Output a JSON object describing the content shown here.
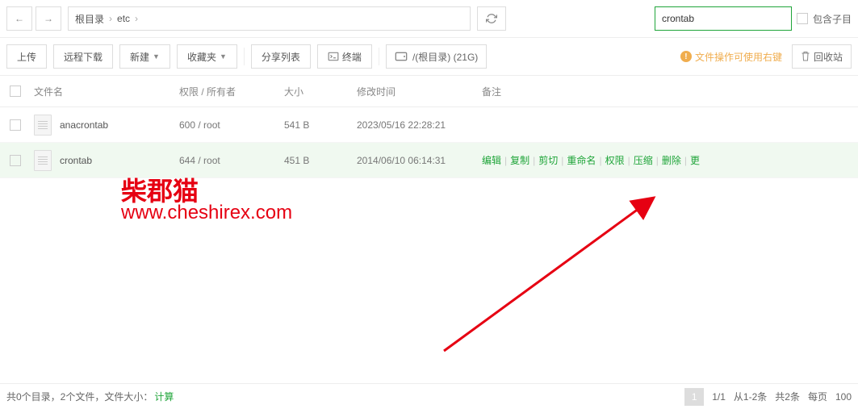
{
  "nav": {
    "root": "根目录",
    "folder": "etc",
    "sep": "›"
  },
  "search": {
    "value": "crontab",
    "sub_label": "包含子目"
  },
  "toolbar": {
    "upload": "上传",
    "remote": "远程下载",
    "new": "新建",
    "favorites": "收藏夹",
    "share": "分享列表",
    "terminal": "终端",
    "folder_btn": "/(根目录) (21G)",
    "tip": "文件操作可使用右键",
    "recycle": "回收站"
  },
  "headers": {
    "name": "文件名",
    "perm": "权限 / 所有者",
    "size": "大小",
    "time": "修改时间",
    "remark": "备注"
  },
  "rows": [
    {
      "name": "anacrontab",
      "perm": "600 / root",
      "size": "541 B",
      "time": "2023/05/16 22:28:21"
    },
    {
      "name": "crontab",
      "perm": "644 / root",
      "size": "451 B",
      "time": "2014/06/10 06:14:31"
    }
  ],
  "actions": {
    "edit": "编辑",
    "copy": "复制",
    "cut": "剪切",
    "rename": "重命名",
    "perm": "权限",
    "compress": "压缩",
    "delete": "删除",
    "more": "更"
  },
  "watermark": {
    "line1": "柴郡猫",
    "line2": "www.cheshirex.com"
  },
  "status": {
    "summary": "共0个目录，2个文件，文件大小：",
    "calc": "计算",
    "page_cur": "1",
    "page_total": "1/1",
    "range": "从1-2条",
    "total": "共2条",
    "per_page": "每页",
    "per_val": "100"
  }
}
